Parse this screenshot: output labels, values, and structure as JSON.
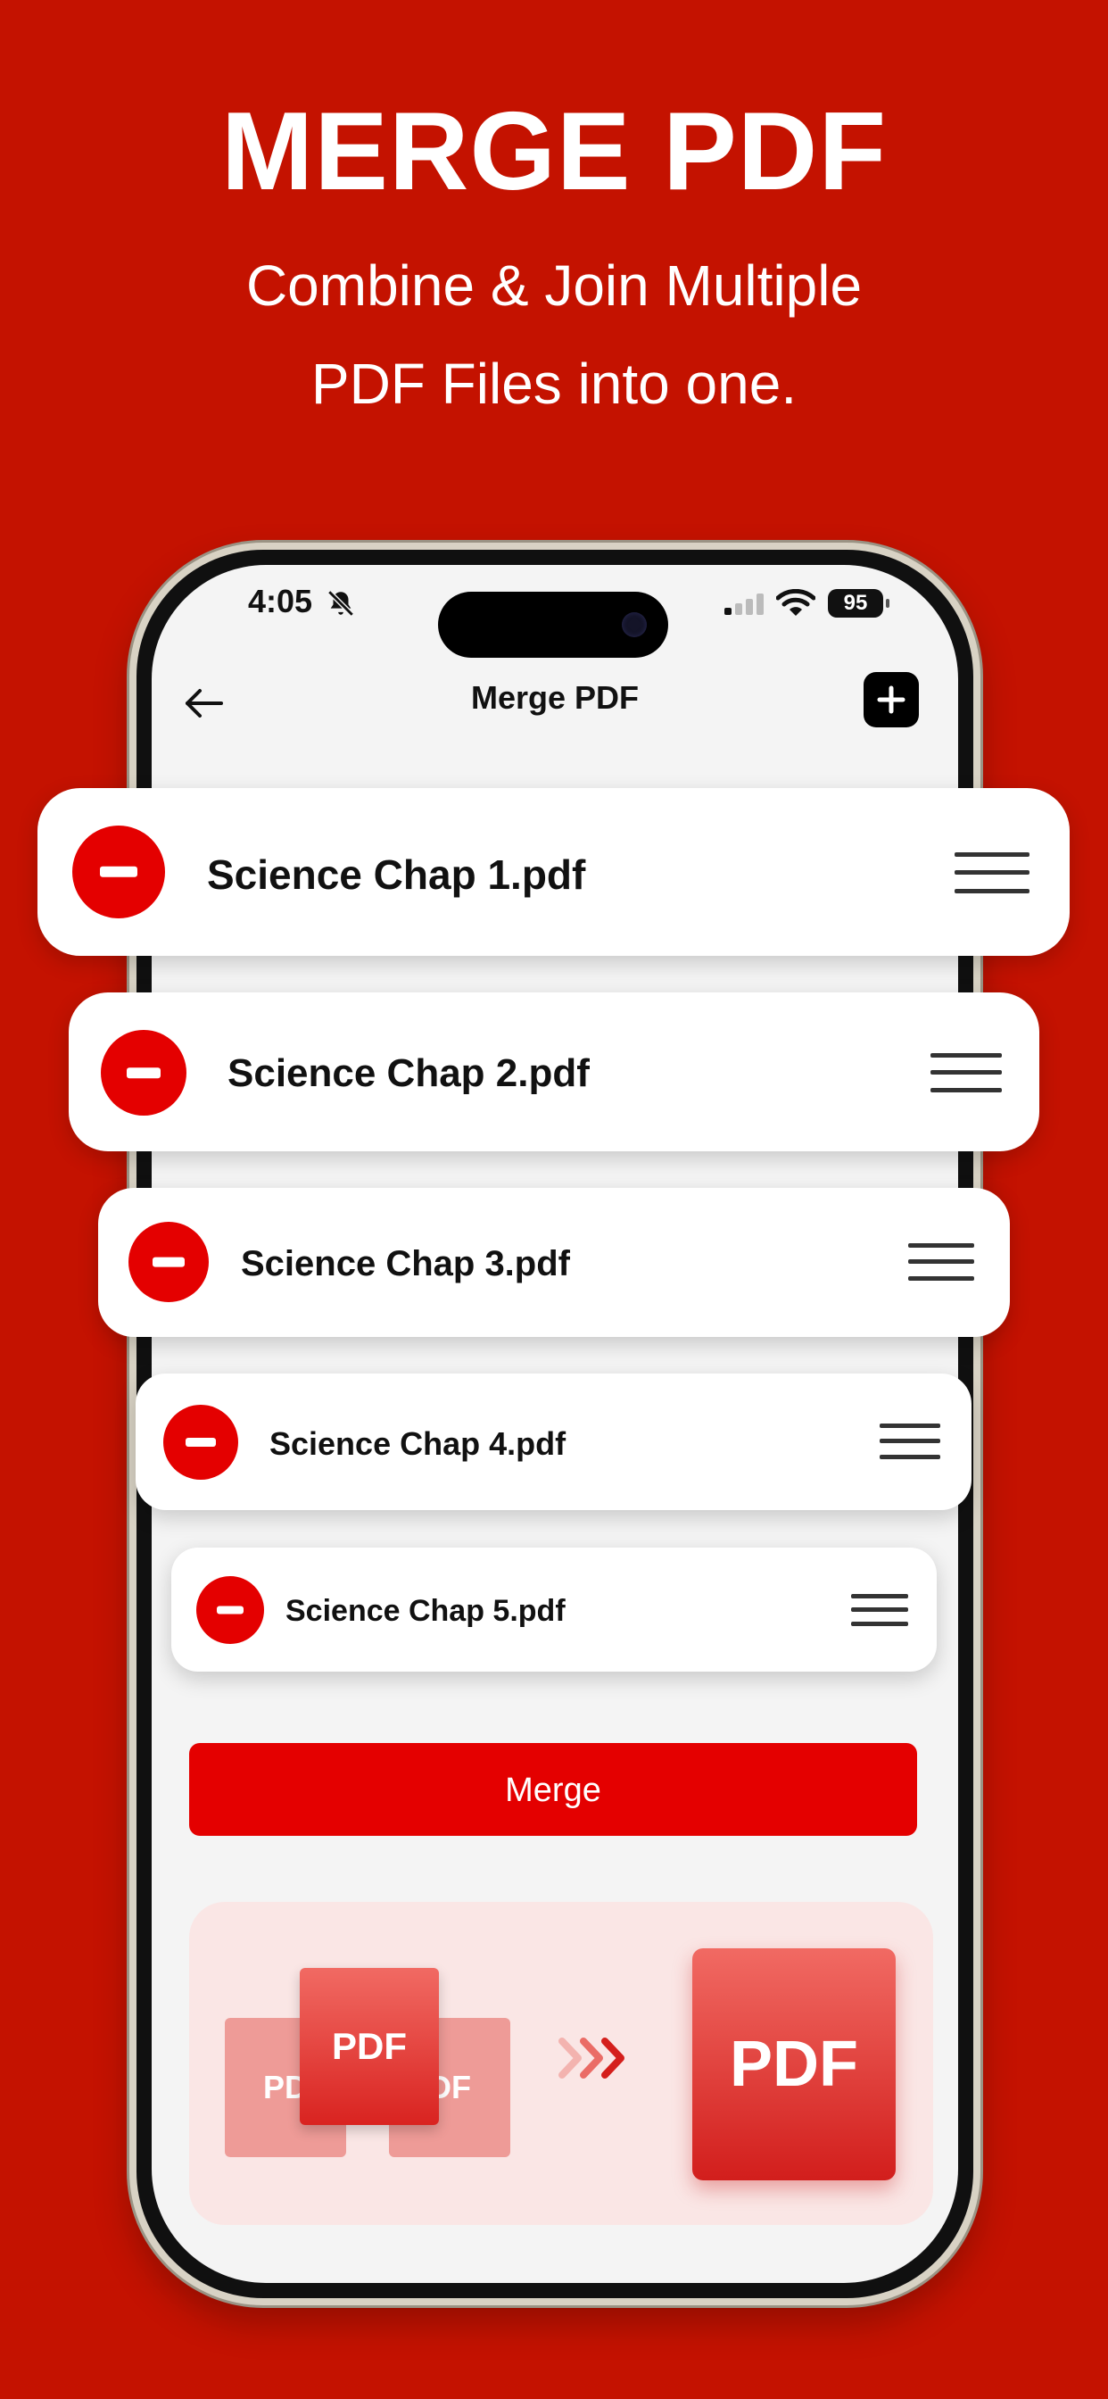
{
  "hero": {
    "title": "MERGE PDF",
    "subtitle_line1": "Combine & Join Multiple",
    "subtitle_line2": "PDF Files into one."
  },
  "status_bar": {
    "time": "4:05",
    "battery": "95"
  },
  "app_bar": {
    "title": "Merge PDF",
    "back_icon": "arrow-left-icon",
    "add_icon": "plus-icon"
  },
  "files": [
    {
      "name": "Science Chap 1.pdf"
    },
    {
      "name": "Science Chap 2.pdf"
    },
    {
      "name": "Science Chap 3.pdf"
    },
    {
      "name": "Science Chap 4.pdf"
    },
    {
      "name": "Science Chap 5.pdf"
    }
  ],
  "merge_button": {
    "label": "Merge"
  },
  "illustration": {
    "front_label": "PDF",
    "back_left_label": "PD",
    "back_right_label": "DF",
    "result_label": "PDF"
  },
  "colors": {
    "background": "#c41200",
    "accent": "#e40000",
    "illustration_bg": "#fae6e5"
  }
}
